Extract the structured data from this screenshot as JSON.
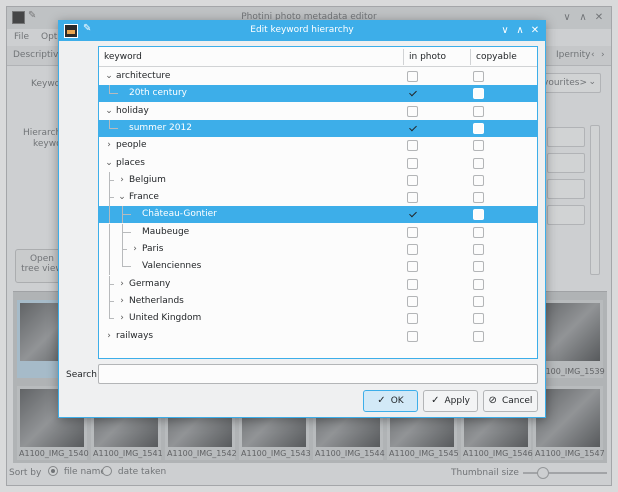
{
  "main_window": {
    "title": "Photini photo metadata editor",
    "menu": [
      "File",
      "Opti"
    ],
    "tabs": [
      "Descriptive",
      "Ipernity"
    ],
    "labels": {
      "keywords": "Keywo",
      "hierarchical_1": "Hierarchi",
      "hierarchical_2": "keywo",
      "favourites": "vourites>"
    },
    "open_tree_view": [
      "Open",
      "tree view"
    ],
    "thumbnails": [
      "A1100_IMG_1540",
      "A1100_IMG_1541",
      "A1100_IMG_1542",
      "A1100_IMG_1543",
      "A1100_IMG_1544",
      "A1100_IMG_1545",
      "A1100_IMG_1546",
      "A1100_IMG_1547"
    ],
    "top_right_thumb": "A1100_IMG_1539",
    "bottom_bar": {
      "sort_by": "Sort by",
      "file_name": "file name",
      "date_taken": "date taken",
      "thumbnail_size": "Thumbnail size"
    }
  },
  "dialog": {
    "title": "Edit keyword hierarchy",
    "columns": {
      "keyword": "keyword",
      "in_photo": "in photo",
      "copyable": "copyable"
    },
    "rows": [
      {
        "label": "architecture",
        "depth": 0,
        "expander": "open"
      },
      {
        "label": "20th century",
        "depth": 1,
        "expander": "none",
        "selected": true,
        "in_photo": true,
        "last": true
      },
      {
        "label": "holiday",
        "depth": 0,
        "expander": "open"
      },
      {
        "label": "summer 2012",
        "depth": 1,
        "expander": "none",
        "selected": true,
        "in_photo": true,
        "last": true
      },
      {
        "label": "people",
        "depth": 0,
        "expander": "closed"
      },
      {
        "label": "places",
        "depth": 0,
        "expander": "open"
      },
      {
        "label": "Belgium",
        "depth": 1,
        "expander": "closed"
      },
      {
        "label": "France",
        "depth": 1,
        "expander": "open"
      },
      {
        "label": "Château-Gontier",
        "depth": 2,
        "expander": "none",
        "selected": true,
        "in_photo": true
      },
      {
        "label": "Maubeuge",
        "depth": 2,
        "expander": "none"
      },
      {
        "label": "Paris",
        "depth": 2,
        "expander": "closed"
      },
      {
        "label": "Valenciennes",
        "depth": 2,
        "expander": "none",
        "last": true
      },
      {
        "label": "Germany",
        "depth": 1,
        "expander": "closed"
      },
      {
        "label": "Netherlands",
        "depth": 1,
        "expander": "closed"
      },
      {
        "label": "United Kingdom",
        "depth": 1,
        "expander": "closed",
        "last": true
      },
      {
        "label": "railways",
        "depth": 0,
        "expander": "closed"
      }
    ],
    "search_label": "Search",
    "search_value": "",
    "buttons": {
      "ok": "OK",
      "apply": "Apply",
      "cancel": "Cancel"
    }
  },
  "colors": {
    "accent": "#3daee9",
    "window_bg": "#eff0f1",
    "text": "#232629"
  },
  "icons": {
    "minimize": "chevron-down-icon",
    "maximize": "chevron-up-icon",
    "close": "close-icon",
    "pin": "pin-icon",
    "ok": "check-icon",
    "apply": "check-icon",
    "cancel": "cancel-icon"
  }
}
